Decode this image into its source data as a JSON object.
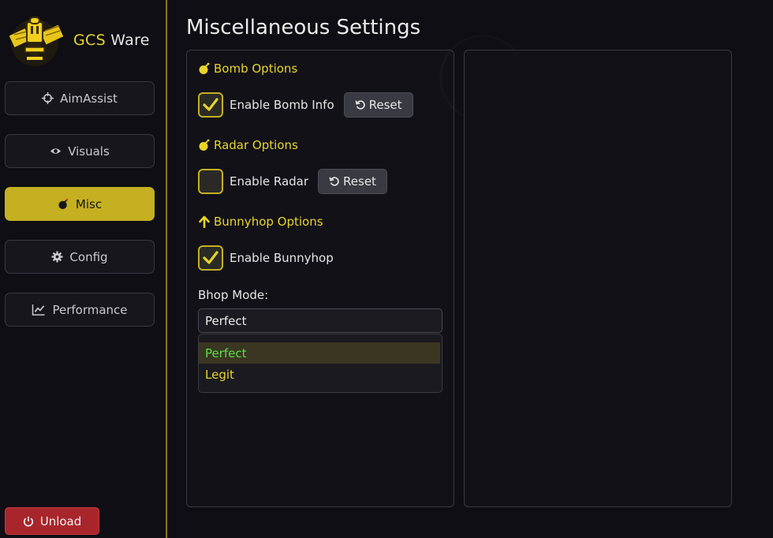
{
  "brand": {
    "part1": "GCS",
    "part2": "Ware"
  },
  "nav": [
    {
      "label": "AimAssist",
      "icon": "crosshair-icon",
      "active": false
    },
    {
      "label": "Visuals",
      "icon": "eye-icon",
      "active": false
    },
    {
      "label": "Misc",
      "icon": "bomb-icon",
      "active": true
    },
    {
      "label": "Config",
      "icon": "gear-icon",
      "active": false
    },
    {
      "label": "Performance",
      "icon": "chart-line-icon",
      "active": false
    }
  ],
  "unload_label": "Unload",
  "page_title": "Miscellaneous Settings",
  "bomb": {
    "title": "Bomb Options",
    "checkbox_label": "Enable Bomb Info",
    "checked": true,
    "reset_label": "Reset"
  },
  "radar": {
    "title": "Radar Options",
    "checkbox_label": "Enable Radar",
    "checked": false,
    "reset_label": "Reset"
  },
  "bunnyhop": {
    "title": "Bunnyhop Options",
    "checkbox_label": "Enable Bunnyhop",
    "checked": true,
    "mode_label": "Bhop Mode:",
    "mode_value": "Perfect",
    "options": [
      "Perfect",
      "Legit"
    ]
  },
  "colors": {
    "accent": "#c4b020",
    "accent_text": "#e8d52a",
    "danger": "#a8262b",
    "selected_option": "#57e04a"
  }
}
